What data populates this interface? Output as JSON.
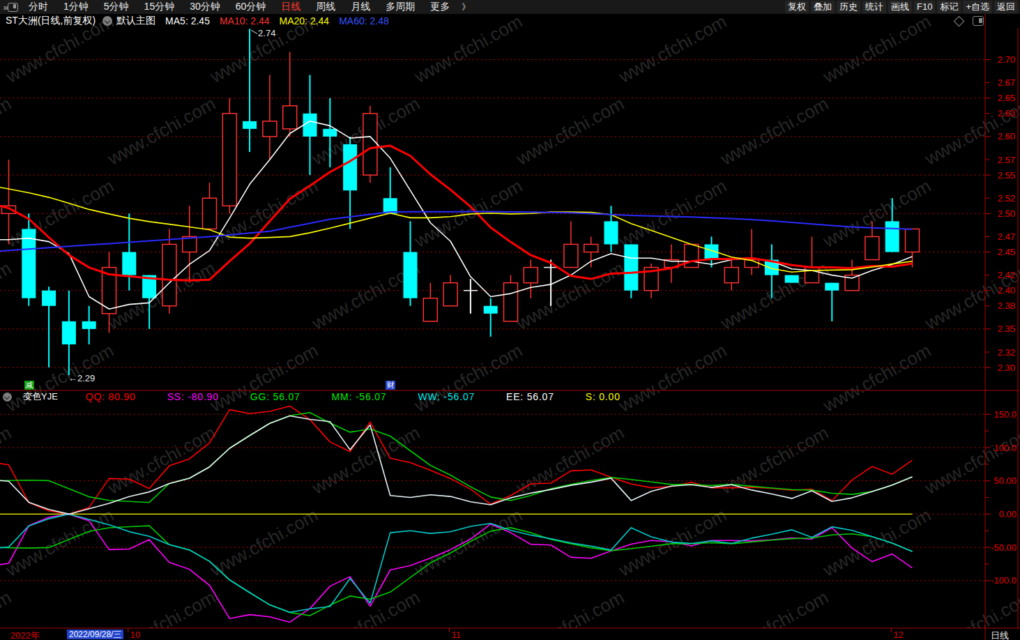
{
  "toolbar": {
    "window_icon": "collapse-panel",
    "menu": [
      {
        "label": "分时",
        "active": false
      },
      {
        "label": "1分钟",
        "active": false
      },
      {
        "label": "5分钟",
        "active": false
      },
      {
        "label": "15分钟",
        "active": false
      },
      {
        "label": "30分钟",
        "active": false
      },
      {
        "label": "60分钟",
        "active": false
      },
      {
        "label": "日线",
        "active": true
      },
      {
        "label": "周线",
        "active": false
      },
      {
        "label": "月线",
        "active": false
      },
      {
        "label": "多周期",
        "active": false
      },
      {
        "label": "更多",
        "active": false
      }
    ],
    "expand_icon": "》",
    "buttons": [
      "复权",
      "叠加",
      "历史",
      "统计",
      "画线",
      "F10",
      "标记",
      "+自选",
      "返回"
    ]
  },
  "title_bar": {
    "symbol_title": "ST大洲(日线,前复权)",
    "overlay_label": "默认主图",
    "ma_labels": [
      {
        "text": "MA5: 2.45",
        "color": "#ffffff"
      },
      {
        "text": "MA10: 2.44",
        "color": "#ff3232"
      },
      {
        "text": "MA20: 2.44",
        "color": "#ffff00"
      },
      {
        "text": "MA60: 2.48",
        "color": "#3653ff"
      }
    ]
  },
  "watermark": {
    "text": "www.cfchi.com"
  },
  "chart_data": {
    "type": "candlestick",
    "symbol": "ST大洲",
    "period": "日线",
    "adjust": "前复权",
    "up_color": "#ff3232",
    "down_color": "#00ffff",
    "doji_color": "#ffffff",
    "candles": [
      [
        2.5,
        2.51,
        2.57,
        2.46
      ],
      [
        2.48,
        2.39,
        2.5,
        2.38
      ],
      [
        2.4,
        2.38,
        2.405,
        2.3
      ],
      [
        2.36,
        2.33,
        2.4,
        2.29
      ],
      [
        2.36,
        2.35,
        2.38,
        2.33
      ],
      [
        2.37,
        2.43,
        2.45,
        2.345
      ],
      [
        2.45,
        2.42,
        2.5,
        2.4
      ],
      [
        2.42,
        2.39,
        2.42,
        2.35
      ],
      [
        2.38,
        2.46,
        2.48,
        2.37
      ],
      [
        2.45,
        2.47,
        2.51,
        2.41
      ],
      [
        2.48,
        2.52,
        2.54,
        2.48
      ],
      [
        2.51,
        2.63,
        2.65,
        2.5
      ],
      [
        2.62,
        2.61,
        2.74,
        2.58
      ],
      [
        2.6,
        2.62,
        2.68,
        2.57
      ],
      [
        2.61,
        2.64,
        2.71,
        2.6
      ],
      [
        2.63,
        2.6,
        2.68,
        2.55
      ],
      [
        2.61,
        2.6,
        2.65,
        2.56
      ],
      [
        2.59,
        2.53,
        2.6,
        2.48
      ],
      [
        2.55,
        2.63,
        2.64,
        2.54
      ],
      [
        2.52,
        2.5,
        2.56,
        2.5
      ],
      [
        2.45,
        2.39,
        2.49,
        2.38
      ],
      [
        2.36,
        2.39,
        2.41,
        2.36
      ],
      [
        2.38,
        2.41,
        2.42,
        2.38
      ],
      [
        2.4,
        2.4,
        2.415,
        2.37
      ],
      [
        2.38,
        2.37,
        2.39,
        2.34
      ],
      [
        2.36,
        2.41,
        2.42,
        2.36
      ],
      [
        2.41,
        2.43,
        2.44,
        2.39
      ],
      [
        2.43,
        2.43,
        2.44,
        2.38
      ],
      [
        2.43,
        2.46,
        2.49,
        2.43
      ],
      [
        2.45,
        2.46,
        2.47,
        2.43
      ],
      [
        2.49,
        2.46,
        2.51,
        2.45
      ],
      [
        2.46,
        2.4,
        2.46,
        2.39
      ],
      [
        2.4,
        2.43,
        2.435,
        2.39
      ],
      [
        2.43,
        2.44,
        2.46,
        2.41
      ],
      [
        2.43,
        2.46,
        2.46,
        2.43
      ],
      [
        2.46,
        2.44,
        2.47,
        2.43
      ],
      [
        2.41,
        2.43,
        2.44,
        2.4
      ],
      [
        2.43,
        2.44,
        2.48,
        2.42
      ],
      [
        2.44,
        2.42,
        2.46,
        2.39
      ],
      [
        2.42,
        2.41,
        2.42,
        2.41
      ],
      [
        2.41,
        2.43,
        2.47,
        2.41
      ],
      [
        2.41,
        2.4,
        2.41,
        2.36
      ],
      [
        2.4,
        2.42,
        2.44,
        2.4
      ],
      [
        2.44,
        2.47,
        2.49,
        2.44
      ],
      [
        2.49,
        2.45,
        2.52,
        2.45
      ],
      [
        2.45,
        2.48,
        2.48,
        2.43
      ]
    ],
    "ma": {
      "ma5": {
        "color": "#ffffff",
        "width": 1.6,
        "edge": 2.466,
        "values": [
          2.466,
          2.468,
          2.4635,
          2.448,
          2.392,
          2.376,
          2.382,
          2.384,
          2.41,
          2.434,
          2.452,
          2.494,
          2.538,
          2.57,
          2.604,
          2.62,
          2.614,
          2.598,
          2.6,
          2.572,
          2.53,
          2.488,
          2.464,
          2.418,
          2.392,
          2.396,
          2.404,
          2.408,
          2.42,
          2.438,
          2.448,
          2.442,
          2.442,
          2.438,
          2.438,
          2.434,
          2.44,
          2.442,
          2.438,
          2.428,
          2.426,
          2.42,
          2.416,
          2.426,
          2.434,
          2.444
        ]
      },
      "ma10": {
        "color": "#ff0000",
        "width": 3,
        "edge": 2.51,
        "values": [
          2.507,
          2.493,
          2.469,
          2.446,
          2.43,
          2.421,
          2.4185,
          2.416,
          2.414,
          2.413,
          2.414,
          2.438,
          2.461,
          2.49,
          2.519,
          2.536,
          2.554,
          2.568,
          2.585,
          2.588,
          2.575,
          2.551,
          2.531,
          2.509,
          2.482,
          2.463,
          2.446,
          2.436,
          2.419,
          2.415,
          2.422,
          2.423,
          2.425,
          2.429,
          2.438,
          2.441,
          2.441,
          2.442,
          2.438,
          2.433,
          2.43,
          2.43,
          2.429,
          2.432,
          2.431,
          2.435
        ]
      },
      "ma20": {
        "color": "#ffff00",
        "width": 1.6,
        "edge": 2.534,
        "values": [
          2.532,
          2.527,
          2.521,
          2.5135,
          2.5053,
          2.4995,
          2.4938,
          2.4895,
          2.4861,
          2.4826,
          2.479,
          2.4694,
          2.468,
          2.4689,
          2.47,
          2.475,
          2.481,
          2.4875,
          2.494,
          2.5005,
          2.4945,
          2.4945,
          2.496,
          2.4995,
          2.5005,
          2.4995,
          2.5,
          2.502,
          2.502,
          2.5015,
          2.4985,
          2.487,
          2.478,
          2.469,
          2.46,
          2.452,
          2.4435,
          2.439,
          2.4285,
          2.424,
          2.426,
          2.4265,
          2.427,
          2.4305,
          2.4345,
          2.438
        ]
      },
      "ma60": {
        "color": "#2b2bff",
        "width": 2,
        "edge": 2.4512,
        "values": [
          2.452,
          2.4538,
          2.4556,
          2.4574,
          2.4592,
          2.461,
          2.4628,
          2.4646,
          2.4664,
          2.4682,
          2.47,
          2.4723,
          2.4747,
          2.477,
          2.4822,
          2.4873,
          2.4925,
          2.4957,
          2.499,
          2.5022,
          2.5023,
          2.5024,
          2.5024,
          2.5025,
          2.5026,
          2.5022,
          2.5018,
          2.5014,
          2.501,
          2.4998,
          2.4987,
          2.4975,
          2.4968,
          2.4962,
          2.4955,
          2.4945,
          2.4935,
          2.492,
          2.4905,
          2.4885,
          2.4865,
          2.4845,
          2.4825,
          2.4815,
          2.4805,
          2.4795
        ]
      }
    },
    "price_axis": [
      {
        "text": "2.70",
        "value": 2.7,
        "grid": true
      },
      {
        "text": "2.67",
        "value": 2.67,
        "grid": false
      },
      {
        "text": "2.65",
        "value": 2.65,
        "grid": true
      },
      {
        "text": "2.63",
        "value": 2.63,
        "grid": false
      },
      {
        "text": "2.60",
        "value": 2.6,
        "grid": true
      },
      {
        "text": "2.57",
        "value": 2.57,
        "grid": false
      },
      {
        "text": "2.55",
        "value": 2.55,
        "grid": true
      },
      {
        "text": "2.52",
        "value": 2.52,
        "grid": false
      },
      {
        "text": "2.50",
        "value": 2.5,
        "grid": true
      },
      {
        "text": "2.47",
        "value": 2.47,
        "grid": false
      },
      {
        "text": "2.45",
        "value": 2.45,
        "grid": true
      },
      {
        "text": "2.42",
        "value": 2.42,
        "grid": false
      },
      {
        "text": "2.40",
        "value": 2.4,
        "grid": true
      },
      {
        "text": "2.38",
        "value": 2.38,
        "grid": false
      },
      {
        "text": "2.35",
        "value": 2.35,
        "grid": true
      },
      {
        "text": "2.32",
        "value": 2.32,
        "grid": false
      },
      {
        "text": "2.30",
        "value": 2.3,
        "grid": true
      }
    ],
    "annotations": {
      "high": {
        "text": "2.74",
        "bar": 12,
        "value": 2.74
      },
      "low": {
        "text": "←2.29",
        "bar": 3,
        "value": 2.29
      }
    },
    "markers": [
      {
        "text": "减",
        "bar": 1,
        "kind": "green"
      },
      {
        "text": "财",
        "bar": 19,
        "kind": "blue"
      }
    ],
    "indicator": {
      "name": "变色YJE",
      "params": [
        {
          "text": "QQ: 80.90",
          "color": "#ff0000"
        },
        {
          "text": "SS: -80.90",
          "color": "#ff00ff"
        },
        {
          "text": "GG: 56.07",
          "color": "#00e600"
        },
        {
          "text": "MM: -56.07",
          "color": "#00e600"
        },
        {
          "text": "WW: -56.07",
          "color": "#00e6e6"
        },
        {
          "text": "EE: 56.07",
          "color": "#ffffff"
        },
        {
          "text": "S: 0.00",
          "color": "#ffff00"
        }
      ],
      "series": [
        {
          "name": "QQ",
          "color": "#ff0000",
          "width": 1.6,
          "edge": 76,
          "values": [
            74,
            17.5,
            4.8,
            0,
            10,
            53.5,
            52.5,
            38.5,
            72.6,
            83,
            107,
            157,
            151.2,
            154.5,
            162.5,
            142,
            108.5,
            94,
            138.5,
            84,
            77.5,
            66,
            53.5,
            37.5,
            15,
            28,
            45.5,
            46.5,
            65,
            66.5,
            55.5,
            45.2,
            39.6,
            41.5,
            47.8,
            39.6,
            39.6,
            40.4,
            38.8,
            35.8,
            37.5,
            20.3,
            51,
            71.5,
            60,
            80.9
          ]
        },
        {
          "name": "SS",
          "color": "#ff00ff",
          "width": 1.6,
          "edge": -76,
          "values": [
            -74,
            -17.5,
            -4.8,
            0,
            -10,
            -53.5,
            -52.5,
            -38.5,
            -72.6,
            -83,
            -107,
            -157,
            -151.2,
            -154.5,
            -162.5,
            -142,
            -108.5,
            -94,
            -138.5,
            -84,
            -77.5,
            -66,
            -53.5,
            -37.5,
            -15,
            -28,
            -45.5,
            -46.5,
            -65,
            -66.5,
            -55.5,
            -45.2,
            -39.6,
            -41.5,
            -47.8,
            -39.6,
            -39.6,
            -40.4,
            -38.8,
            -35.8,
            -37.5,
            -20.3,
            -51,
            -71.5,
            -60,
            -80.9
          ]
        },
        {
          "name": "GG",
          "color": "#00cc00",
          "width": 1.6,
          "edge": 50.2,
          "values": [
            50.5,
            51,
            50.3,
            38,
            26,
            20.5,
            19,
            17.5,
            46,
            54,
            71,
            99,
            118,
            136.5,
            148,
            152.6,
            137,
            123.2,
            128,
            117.3,
            95.3,
            73.3,
            58.6,
            41,
            25.7,
            20.4,
            28,
            38.1,
            44.5,
            50.5,
            55,
            52,
            48.3,
            44.5,
            44.5,
            43,
            44.5,
            41.9,
            39.2,
            36.9,
            36,
            31.3,
            29.7,
            33.9,
            43.6,
            56.07
          ]
        },
        {
          "name": "MM",
          "color": "#00cc00",
          "width": 1.6,
          "edge": -50.2,
          "values": [
            -50.5,
            -51,
            -50.3,
            -38,
            -26,
            -20.5,
            -19,
            -17.5,
            -46,
            -54,
            -71,
            -99,
            -118,
            -136.5,
            -148,
            -152.6,
            -137,
            -123.2,
            -128,
            -117.3,
            -95.3,
            -73.3,
            -58.6,
            -41,
            -25.7,
            -20.4,
            -28,
            -38.1,
            -44.5,
            -50.5,
            -55,
            -52,
            -48.3,
            -44.5,
            -44.5,
            -43,
            -44.5,
            -41.9,
            -39.2,
            -36.9,
            -36,
            -31.3,
            -29.7,
            -33.9,
            -43.6,
            -56.07
          ]
        },
        {
          "name": "WW",
          "color": "#00cccc",
          "width": 1.6,
          "edge": -50.5,
          "values": [
            -49.5,
            -17.8,
            -7,
            0,
            -8,
            -16,
            -26.4,
            -33.3,
            -45.9,
            -53.9,
            -71,
            -99,
            -118,
            -136.5,
            -147.7,
            -142.5,
            -139,
            -96.8,
            -134,
            -28,
            -25,
            -29,
            -26.5,
            -18.5,
            -14,
            -24.4,
            -31.6,
            -37,
            -43.3,
            -48,
            -54,
            -20.4,
            -34.3,
            -42.1,
            -44.1,
            -40.1,
            -44.1,
            -36.2,
            -30.3,
            -23.6,
            -35,
            -19.1,
            -24.4,
            -33.9,
            -43.6,
            -56.07
          ]
        },
        {
          "name": "EE",
          "color": "#e8f4f8",
          "width": 1.6,
          "edge": 50.5,
          "values": [
            49.5,
            17.8,
            7,
            0,
            8,
            16,
            26.4,
            33.3,
            45.9,
            53.9,
            71,
            99,
            118,
            136.5,
            147.7,
            142.5,
            139,
            96.8,
            134,
            28,
            25,
            29,
            26.5,
            18.5,
            14,
            24.4,
            31.6,
            37,
            43.3,
            48,
            54,
            20.4,
            34.3,
            42.1,
            44.1,
            40.1,
            44.1,
            36.2,
            30.3,
            23.6,
            35,
            19.1,
            24.4,
            33.9,
            43.6,
            56.07
          ]
        }
      ],
      "zero_line": {
        "value": 0,
        "color": "#ffff00"
      },
      "value_axis": [
        {
          "text": "150.0",
          "value": 150
        },
        {
          "text": "100.0",
          "value": 100
        },
        {
          "text": "50.00",
          "value": 50
        },
        {
          "text": "0.00",
          "value": 0
        },
        {
          "text": "-50.00",
          "value": -50
        },
        {
          "text": "-100.0",
          "value": -100
        }
      ]
    },
    "x_axis": {
      "year": "2022年",
      "date_box": "2022/09/28/三",
      "month_ticks": [
        {
          "label": "10",
          "bar": 6
        },
        {
          "label": "11",
          "bar": 22
        },
        {
          "label": "12",
          "bar": 44
        }
      ],
      "period_label": "日线"
    }
  }
}
